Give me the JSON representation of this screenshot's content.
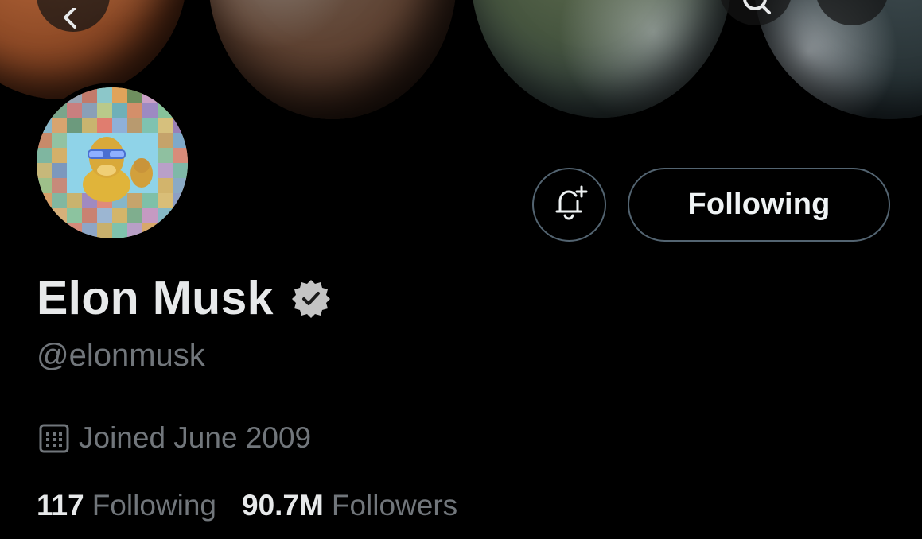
{
  "profile": {
    "display_name": "Elon Musk",
    "handle": "@elonmusk",
    "joined": "Joined June 2009",
    "verified": true
  },
  "stats": {
    "following_count": "117",
    "following_label": "Following",
    "followers_count": "90.7M",
    "followers_label": "Followers"
  },
  "actions": {
    "follow_state_label": "Following"
  },
  "icons": {
    "back": "arrow-left-icon",
    "search": "search-icon",
    "more": "more-icon",
    "notify": "bell-plus-icon",
    "verified": "verified-badge-icon",
    "calendar": "calendar-icon"
  },
  "colors": {
    "background": "#000000",
    "primary_text": "#e7e9ea",
    "secondary_text": "#71767b",
    "button_border": "#536471"
  }
}
